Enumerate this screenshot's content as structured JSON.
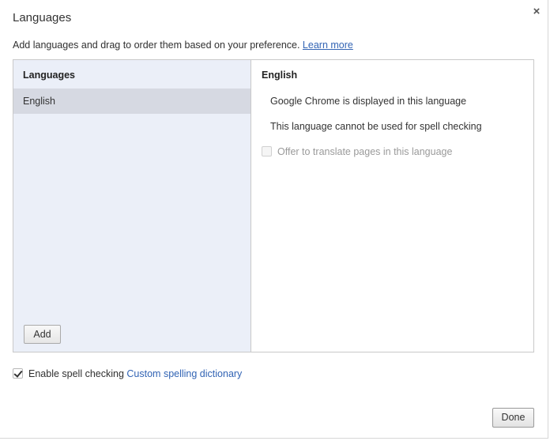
{
  "dialog": {
    "title": "Languages",
    "close_glyph": "×",
    "intro_text": "Add languages and drag to order them based on your preference. ",
    "learn_more": "Learn more"
  },
  "language_list": {
    "header": "Languages",
    "items": [
      {
        "label": "English",
        "selected": true
      }
    ],
    "add_button": "Add"
  },
  "details": {
    "title": "English",
    "display_note": "Google Chrome is displayed in this language",
    "spell_note": "This language cannot be used for spell checking",
    "translate_label": "Offer to translate pages in this language",
    "translate_checked": false
  },
  "footer": {
    "spellcheck_label": "Enable spell checking",
    "spellcheck_checked": true,
    "custom_dictionary_link": "Custom spelling dictionary",
    "done_button": "Done"
  },
  "icons": {
    "close": "close-icon",
    "checkbox": "checkbox-icon"
  },
  "colors": {
    "link": "#3264b4",
    "list_background": "#ebeff8",
    "selected_item": "#d6d9e2"
  }
}
